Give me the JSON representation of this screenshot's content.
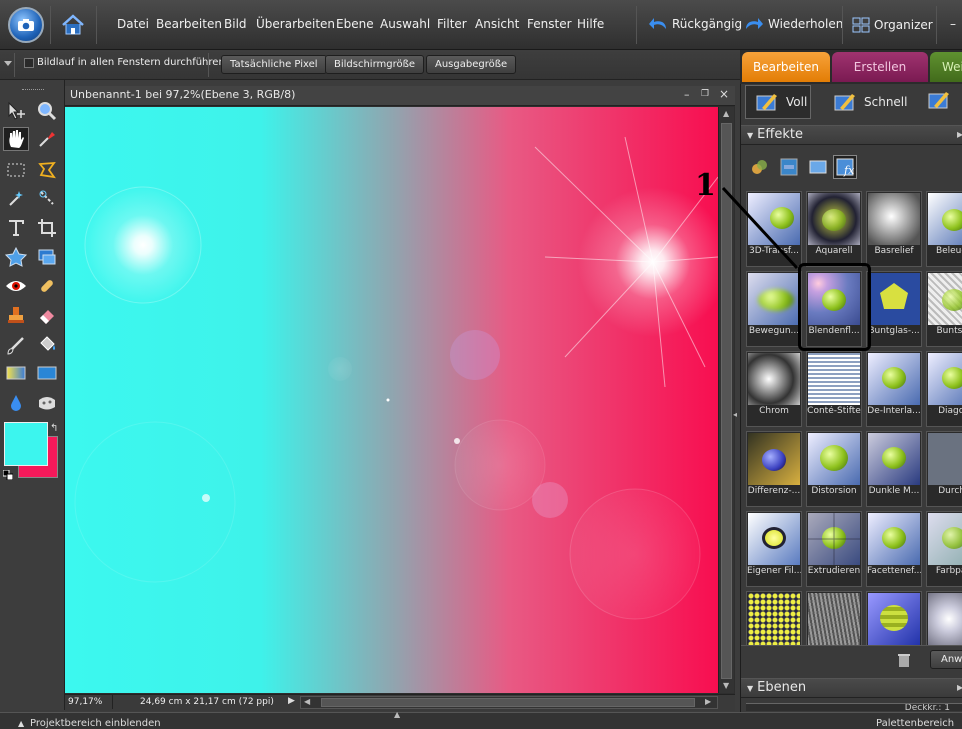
{
  "menubar": {
    "items": [
      "Datei",
      "Bearbeiten",
      "Bild",
      "Überarbeiten",
      "Ebene",
      "Auswahl",
      "Filter",
      "Ansicht",
      "Fenster",
      "Hilfe"
    ],
    "undo_label": "Rückgängig",
    "redo_label": "Wiederholen",
    "organizer_label": "Organizer",
    "minimize_label": "–"
  },
  "options": {
    "scroll_all_label": "Bildlauf in allen Fenstern durchführen",
    "actual_pixels": "Tatsächliche Pixel",
    "screen_size": "Bildschirmgröße",
    "print_size": "Ausgabegröße"
  },
  "tabs": {
    "edit": "Bearbeiten",
    "create": "Erstellen",
    "share": "Wei"
  },
  "modes": {
    "full": "Voll",
    "quick": "Schnell"
  },
  "document": {
    "title": "Unbenannt-1 bei 97,2%(Ebene 3, RGB/8)",
    "zoom": "97,17%",
    "dimensions": "24,69 cm x 21,17 cm (72 ppi)"
  },
  "effects": {
    "header": "Effekte",
    "annotation": "1",
    "rows": [
      [
        "3D-Transf...",
        "Aquarell",
        "Basrelief",
        "Beleuch"
      ],
      [
        "Bewegun...",
        "Blendenfl...",
        "Buntglas-...",
        "Buntstif"
      ],
      [
        "Chrom",
        "Conté-Stifte",
        "De-Interla...",
        "Diagon"
      ],
      [
        "Differenz-...",
        "Distorsion",
        "Dunkle M...",
        "Durchs"
      ],
      [
        "Eigener Fil...",
        "Extrudieren",
        "Facettenef...",
        "Farbpap"
      ],
      [
        "",
        "",
        "",
        ""
      ]
    ],
    "apply_label": "Anw"
  },
  "layers": {
    "header": "Ebenen",
    "value": "Deckkr.: 1"
  },
  "bottom": {
    "project_bin": "Projektbereich einblenden",
    "palette_bin": "Palettenbereich"
  },
  "colors": {
    "foreground": "#3cf5ee",
    "background": "#f5195a",
    "active_tab": "#f08a12",
    "create_tab": "#8a1f5e",
    "share_tab": "#4f7b24"
  }
}
